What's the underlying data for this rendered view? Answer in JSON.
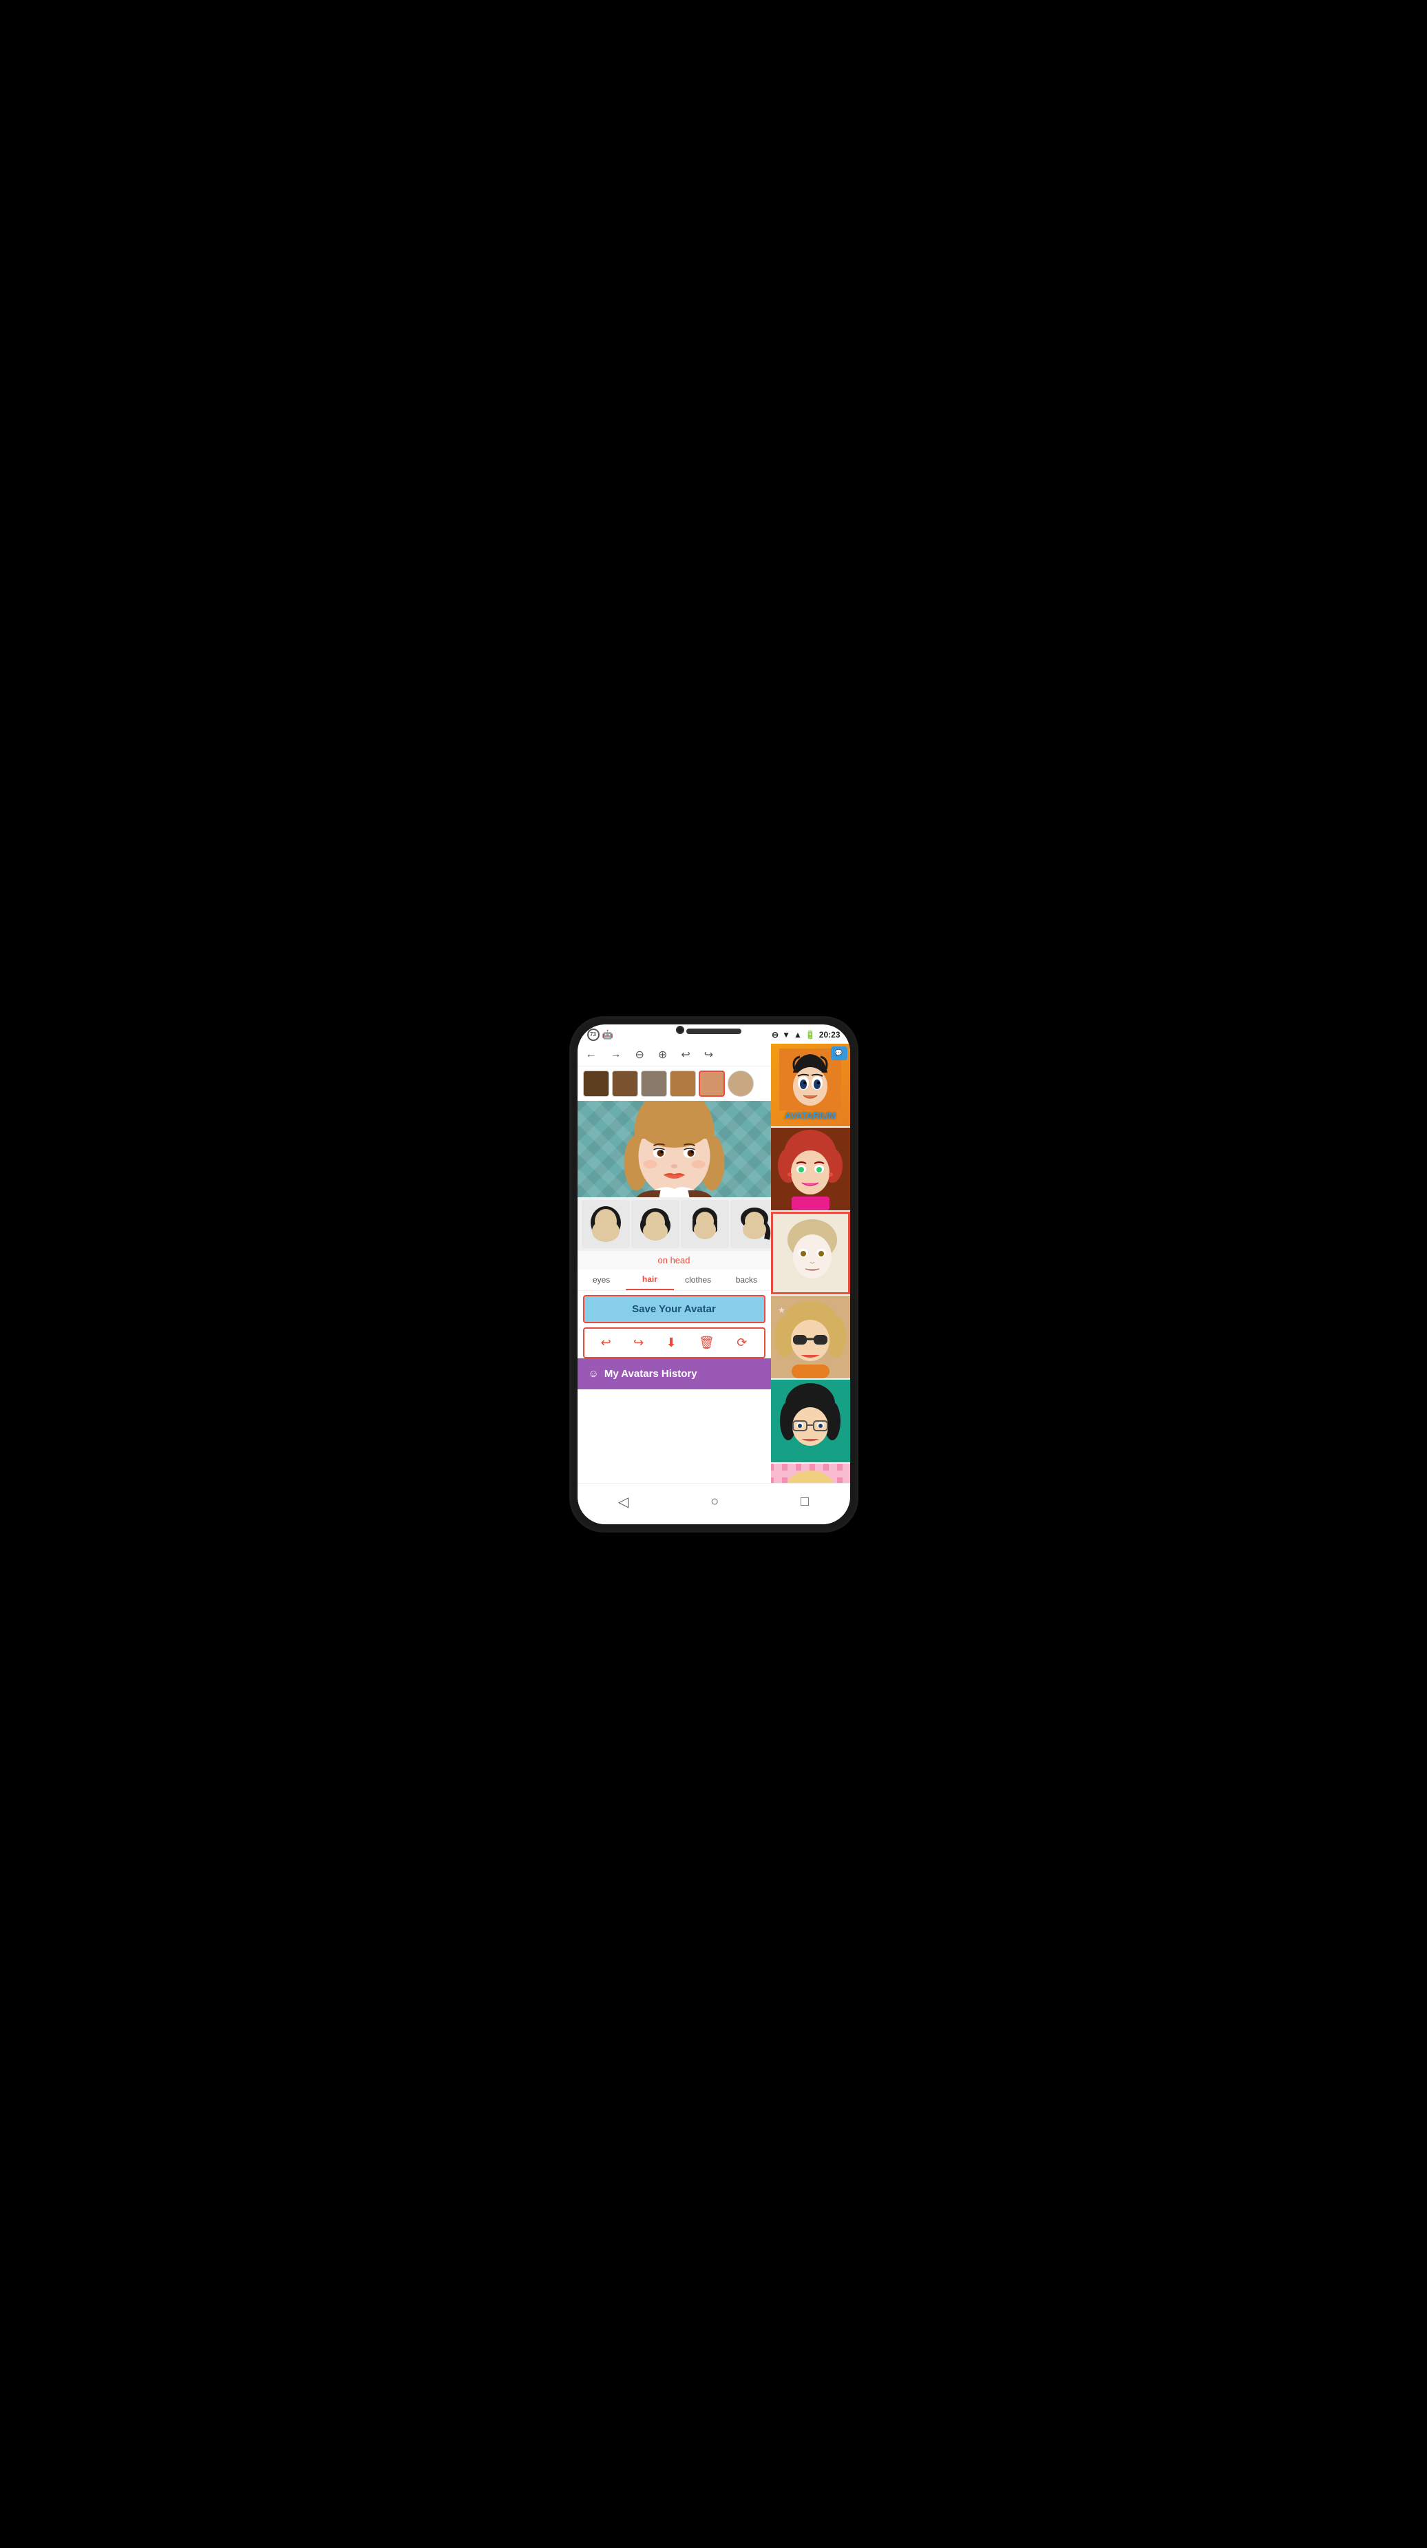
{
  "status_bar": {
    "battery_level": "73",
    "android_icon": "🤖",
    "time": "20:23",
    "signal_icons": "▼▲"
  },
  "toolbar": {
    "back_label": "←",
    "forward_label": "→",
    "zoom_out_label": "⊖",
    "zoom_in_label": "⊕",
    "undo_label": "↩",
    "redo_label": "↪"
  },
  "color_swatches": [
    {
      "color": "#5c3d1e",
      "selected": false
    },
    {
      "color": "#7a5230",
      "selected": false
    },
    {
      "color": "#8a7a6a",
      "selected": false
    },
    {
      "color": "#b07a40",
      "selected": false
    },
    {
      "color": "#d4956a",
      "selected": true
    },
    {
      "color": "#c8a882",
      "selected": false
    }
  ],
  "on_head_label": "on head",
  "category_tabs": [
    {
      "label": "eyes",
      "active": false
    },
    {
      "label": "hair",
      "active": true
    },
    {
      "label": "clothes",
      "active": false
    },
    {
      "label": "backs",
      "active": false
    }
  ],
  "save_button_label": "Save Your Avatar",
  "action_buttons": [
    {
      "icon": "↩",
      "label": "share"
    },
    {
      "icon": "↪",
      "label": "share-ext"
    },
    {
      "icon": "⬇",
      "label": "download"
    },
    {
      "icon": "🗑",
      "label": "delete"
    },
    {
      "icon": "⟳",
      "label": "reset"
    }
  ],
  "avatars_history": {
    "icon": "☺",
    "label": "My Avatars History"
  },
  "gallery": [
    {
      "id": "avatarium",
      "bg": "orange",
      "label": "AVATARIUM"
    },
    {
      "id": "redhead",
      "bg": "brown"
    },
    {
      "id": "blonde-selected",
      "bg": "pink",
      "selected": true
    },
    {
      "id": "sunglasses",
      "bg": "orange2"
    },
    {
      "id": "dark-hair",
      "bg": "teal"
    },
    {
      "id": "vampire",
      "bg": "pink2"
    }
  ],
  "nav_bar": {
    "back_label": "◁",
    "home_label": "○",
    "recent_label": "□"
  }
}
